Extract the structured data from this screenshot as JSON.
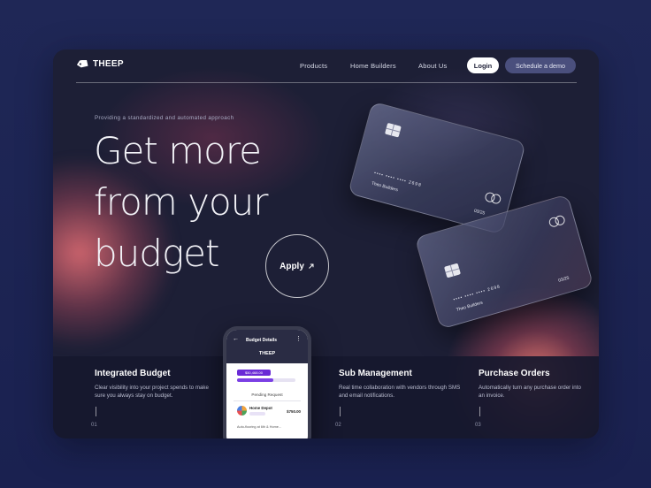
{
  "nav": {
    "brand": "THEEP",
    "links": [
      "Products",
      "Home Builders",
      "About Us"
    ],
    "login_label": "Login",
    "demo_label": "Schedule a demo"
  },
  "hero": {
    "eyebrow": "Providing a standardized and automated approach",
    "headline_lines": [
      "Get more",
      "from your",
      "budget"
    ],
    "apply_label": "Apply",
    "apply_icon": "arrow-up-right"
  },
  "cards": [
    {
      "number": "•••• •••• •••• 2698",
      "holder": "Theo Builders",
      "expiry": "03/25"
    },
    {
      "number": "•••• •••• •••• 2698",
      "holder": "Theo Builders",
      "expiry": "03/25"
    }
  ],
  "features": [
    {
      "title": "Integrated Budget",
      "desc": "Clear visibility into your project spends to make sure you always stay on budget.",
      "num": "01"
    },
    {
      "title": "Sub Management",
      "desc": "Real time collaboration with vendors through SMS and email notifications.",
      "num": "02"
    },
    {
      "title": "Purchase Orders",
      "desc": "Automatically turn any purchase order into an invoice.",
      "num": "03"
    }
  ],
  "phone": {
    "title": "Budget Details",
    "brand": "THEEP",
    "amount": "$50,468.00",
    "budget_progress": 0.62,
    "pending_label": "Pending Request",
    "vendor": "Home Depot",
    "price": "$750.00",
    "note": "Auto-flooring at 6th & Home..."
  },
  "colors": {
    "frame_bg": "#1d1f36",
    "page_bg": "#1f2756",
    "accent_glow": "#d66870",
    "demo_button": "#4a4f7d",
    "phone_accent": "#6a2bd6"
  }
}
